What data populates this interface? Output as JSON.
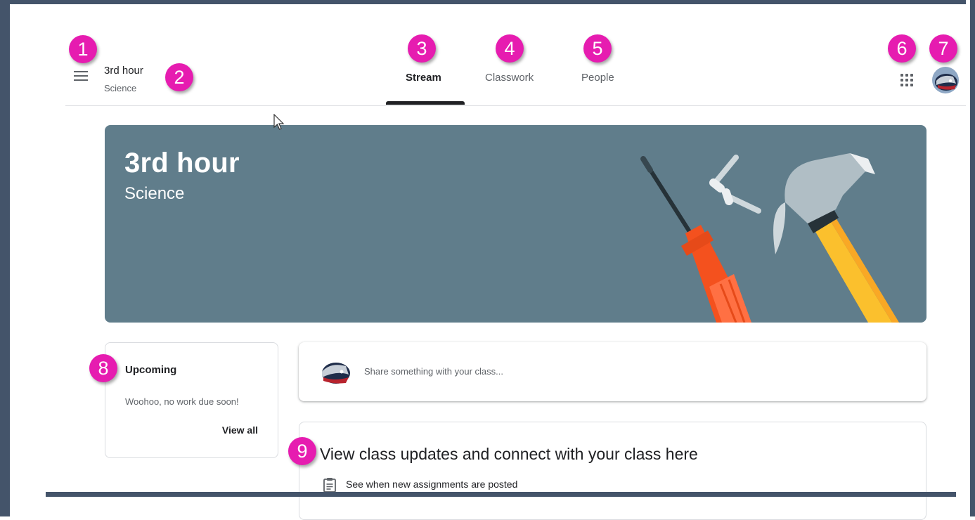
{
  "header": {
    "class_name": "3rd hour",
    "class_section": "Science",
    "tabs": [
      {
        "label": "Stream",
        "active": true
      },
      {
        "label": "Classwork",
        "active": false
      },
      {
        "label": "People",
        "active": false
      }
    ],
    "apps_icon": "apps-grid-icon",
    "menu_icon": "hamburger-menu-icon"
  },
  "banner": {
    "title": "3rd hour",
    "subtitle": "Science",
    "color": "#607d8b"
  },
  "upcoming": {
    "title": "Upcoming",
    "empty_text": "Woohoo, no work due soon!",
    "view_all_label": "View all"
  },
  "share": {
    "placeholder": "Share something with your class..."
  },
  "updates": {
    "title": "View class updates and connect with your class here",
    "items": [
      "See when new assignments are posted"
    ]
  },
  "callouts": [
    "1",
    "2",
    "3",
    "4",
    "5",
    "6",
    "7",
    "8",
    "9"
  ],
  "colors": {
    "callout": "#e61cb0",
    "frame": "#44546a",
    "text_primary": "#202124",
    "text_secondary": "#5f6368"
  }
}
